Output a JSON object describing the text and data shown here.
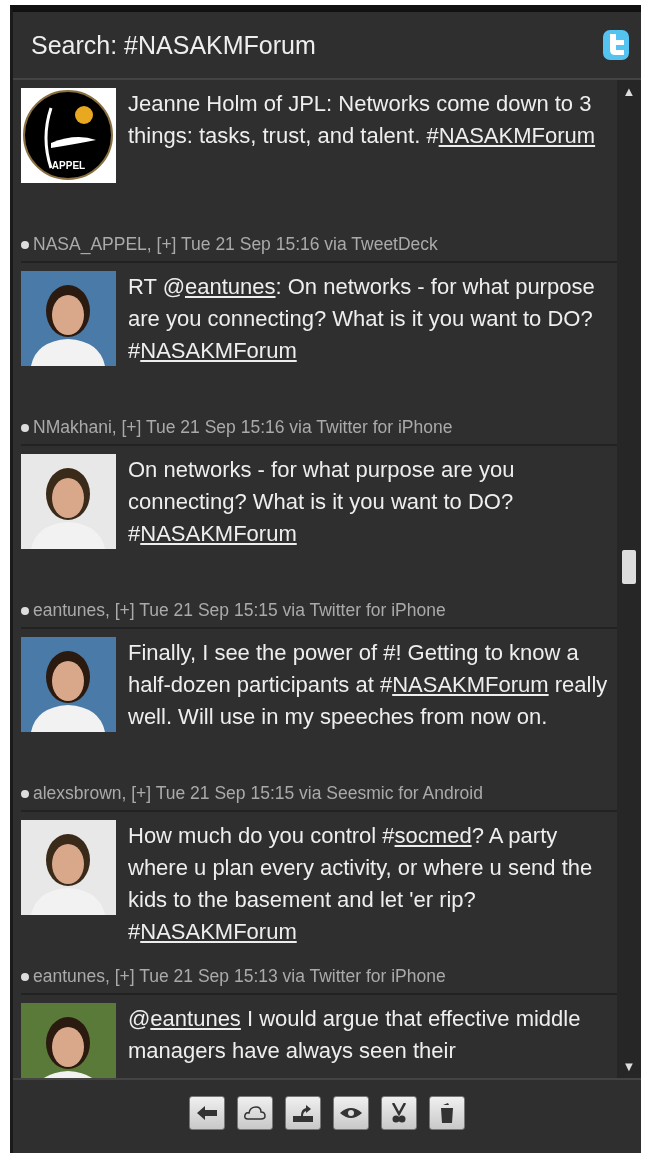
{
  "header": {
    "title": "Search: #NASAKMForum"
  },
  "tweets": [
    {
      "avatar": {
        "kind": "logo",
        "label": "APPEL"
      },
      "text": [
        {
          "text": "Jeanne Holm of JPL: Networks come down to 3 things: tasks, trust, and talent. #"
        },
        {
          "text": "NASAKMForum",
          "link": true
        }
      ],
      "meta": "NASA_APPEL, [+] Tue 21 Sep 15:16 via TweetDeck"
    },
    {
      "avatar": {
        "kind": "picture"
      },
      "text": [
        {
          "text": "RT @"
        },
        {
          "text": "eantunes",
          "link": true
        },
        {
          "text": ": On networks - for what purpose are you connecting? What is it you want to DO? #"
        },
        {
          "text": "NASAKMForum",
          "link": true
        }
      ],
      "meta": "NMakhani, [+] Tue 21 Sep 15:16 via Twitter for iPhone"
    },
    {
      "avatar": {
        "kind": "picture"
      },
      "text": [
        {
          "text": "On networks - for what purpose are you connecting? What is it you want to DO? #"
        },
        {
          "text": "NASAKMForum",
          "link": true
        }
      ],
      "meta": "eantunes, [+] Tue 21 Sep 15:15 via Twitter for iPhone"
    },
    {
      "avatar": {
        "kind": "picture"
      },
      "text": [
        {
          "text": "Finally, I see the power of #! Getting to know a half-dozen participants at #"
        },
        {
          "text": "NASAKMForum",
          "link": true
        },
        {
          "text": " really well. Will use in my speeches from now on."
        }
      ],
      "meta": "alexsbrown, [+] Tue 21 Sep 15:15 via Seesmic for Android"
    },
    {
      "avatar": {
        "kind": "picture"
      },
      "text": [
        {
          "text": "How much do you control #"
        },
        {
          "text": "socmed",
          "link": true
        },
        {
          "text": "? A party where u plan every activity, or where u send the kids to the basement and let 'er rip? #"
        },
        {
          "text": "NASAKMForum",
          "link": true
        }
      ],
      "meta": "eantunes, [+] Tue 21 Sep 15:13 via Twitter for iPhone"
    },
    {
      "avatar": {
        "kind": "picture"
      },
      "text": [
        {
          "text": "@"
        },
        {
          "text": "eantunes",
          "link": true
        },
        {
          "text": " I would argue that effective middle managers have always seen their"
        }
      ]
    }
  ],
  "scrollbar": {
    "up": "▲",
    "down": "▼"
  },
  "toolbar": [
    {
      "kind": "back"
    },
    {
      "kind": "cloud"
    },
    {
      "kind": "upload"
    },
    {
      "kind": "eye"
    },
    {
      "kind": "scissors"
    },
    {
      "kind": "trash"
    }
  ]
}
